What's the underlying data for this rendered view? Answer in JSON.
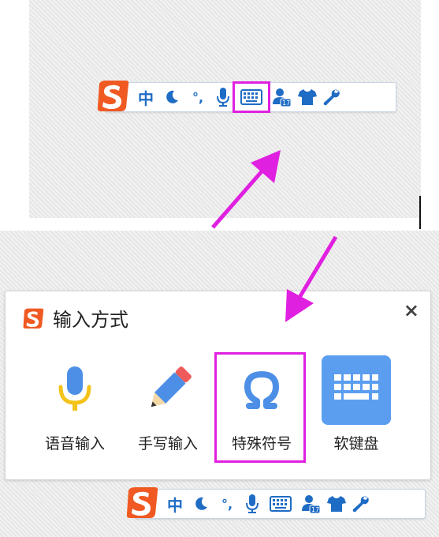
{
  "toolbar": {
    "lang_label": "中",
    "punct_label": "°,"
  },
  "dialog": {
    "title": "输入方式",
    "close": "×",
    "options": [
      {
        "label": "语音输入",
        "icon": "microphone-icon"
      },
      {
        "label": "手写输入",
        "icon": "pencil-icon"
      },
      {
        "label": "特殊符号",
        "icon": "omega-icon"
      },
      {
        "label": "软键盘",
        "icon": "keyboard-icon"
      }
    ]
  },
  "colors": {
    "accent": "#1f6cc4",
    "highlight": "#e020e0",
    "sogou_orange": "#f05a22",
    "mic_yellow": "#f4c31a",
    "keyboard_bg": "#5b9ef0"
  }
}
